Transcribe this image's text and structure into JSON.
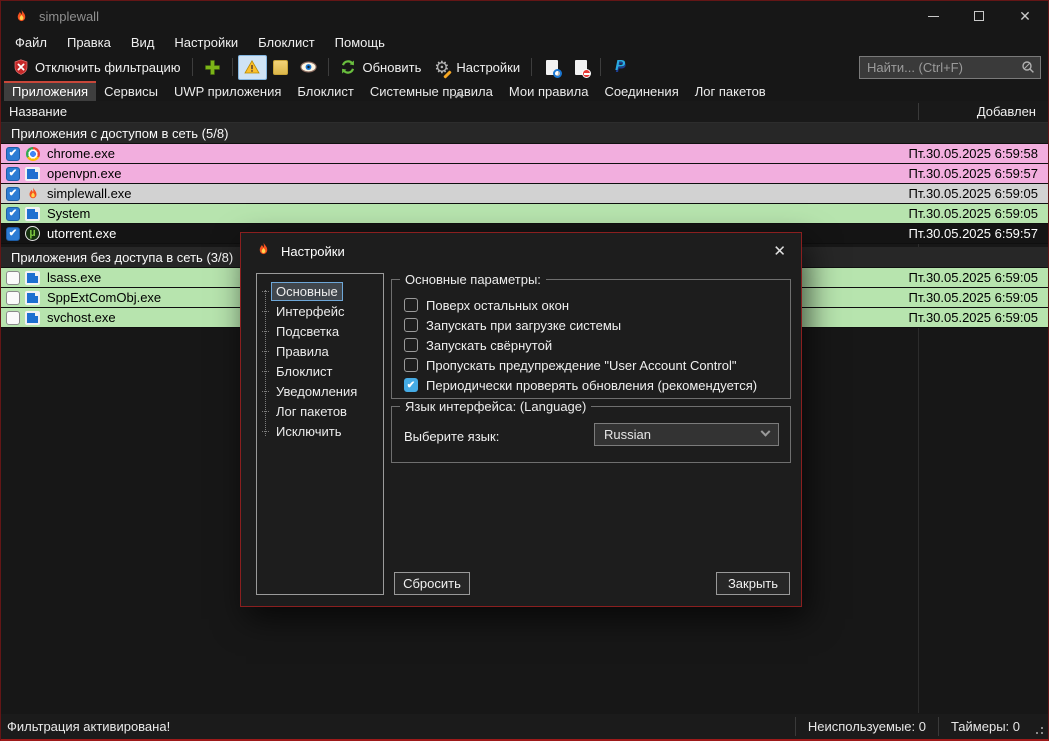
{
  "titlebar": {
    "app_title": "simplewall"
  },
  "menu": {
    "items": [
      "Файл",
      "Правка",
      "Вид",
      "Настройки",
      "Блоклист",
      "Помощь"
    ]
  },
  "toolbar": {
    "disable_filtering_label": "Отключить фильтрацию",
    "refresh_label": "Обновить",
    "settings_label": "Настройки",
    "search_placeholder": "Найти... (Ctrl+F)",
    "icons": [
      "shield-x-icon",
      "plus-icon",
      "warning-triangle-icon",
      "yellow-square-icon",
      "eye-icon",
      "refresh-icon",
      "gear-icon",
      "document-search-icon",
      "document-remove-icon",
      "paypal-icon",
      "search-icon"
    ]
  },
  "tabs": {
    "items": [
      "Приложения",
      "Сервисы",
      "UWP приложения",
      "Блоклист",
      "Системные правила",
      "Мои правила",
      "Соединения",
      "Лог пакетов"
    ],
    "selected": "Приложения"
  },
  "list": {
    "columns": {
      "name": "Название",
      "added": "Добавлен"
    },
    "groups": [
      {
        "label": "Приложения с доступом в сеть (5/8)",
        "rows": [
          {
            "name": "chrome.exe",
            "added": "Пт.30.05.2025 6:59:58",
            "checked": true,
            "icon": "chrome-icon",
            "highlight": "pink"
          },
          {
            "name": "openvpn.exe",
            "added": "Пт.30.05.2025 6:59:57",
            "checked": true,
            "icon": "app-window-icon",
            "highlight": "pink"
          },
          {
            "name": "simplewall.exe",
            "added": "Пт.30.05.2025 6:59:05",
            "checked": true,
            "icon": "flame-icon",
            "highlight": "selected-gray"
          },
          {
            "name": "System",
            "added": "Пт.30.05.2025 6:59:05",
            "checked": true,
            "icon": "app-window-icon",
            "highlight": "green"
          },
          {
            "name": "utorrent.exe",
            "added": "Пт.30.05.2025 6:59:57",
            "checked": true,
            "icon": "utorrent-icon",
            "highlight": "none"
          }
        ]
      },
      {
        "label": "Приложения без доступа в сеть (3/8)",
        "rows": [
          {
            "name": "lsass.exe",
            "added": "Пт.30.05.2025 6:59:05",
            "checked": false,
            "icon": "app-window-icon",
            "highlight": "green"
          },
          {
            "name": "SppExtComObj.exe",
            "added": "Пт.30.05.2025 6:59:05",
            "checked": false,
            "icon": "app-window-icon",
            "highlight": "green"
          },
          {
            "name": "svchost.exe",
            "added": "Пт.30.05.2025 6:59:05",
            "checked": false,
            "icon": "app-window-icon",
            "highlight": "green"
          }
        ]
      }
    ]
  },
  "dialog": {
    "title": "Настройки",
    "tree": {
      "items": [
        "Основные",
        "Интерфейс",
        "Подсветка",
        "Правила",
        "Блоклист",
        "Уведомления",
        "Лог пакетов",
        "Исключить"
      ],
      "selected": "Основные"
    },
    "general_group_label": "Основные параметры:",
    "checkboxes": [
      {
        "label": "Поверх остальных окон",
        "checked": false
      },
      {
        "label": "Запускать при загрузке системы",
        "checked": false
      },
      {
        "label": "Запускать свёрнутой",
        "checked": false
      },
      {
        "label": "Пропускать предупреждение \"User Account Control\"",
        "checked": false
      },
      {
        "label": "Периодически проверять обновления (рекомендуется)",
        "checked": true
      }
    ],
    "language_group_label": "Язык интерфейса: (Language)",
    "language_label": "Выберите язык:",
    "language_value": "Russian",
    "reset_button": "Сбросить",
    "close_button": "Закрыть"
  },
  "statusbar": {
    "left": "Фильтрация активирована!",
    "unused": "Неиспользуемые: 0",
    "timers": "Таймеры: 0"
  },
  "colors": {
    "window_border": "#641616",
    "accent_bottom": "#9e1a1a",
    "row_pink": "#f2aede",
    "row_green": "#b7e4ae",
    "row_selected_gray": "#d2d2d2",
    "list_checkbox_blue": "#2d7cd4",
    "dialog_checkbox_blue": "#45abe5",
    "tab_accent_red": "#c9473a",
    "toolbar_selected_bg": "#cfe3f5"
  }
}
